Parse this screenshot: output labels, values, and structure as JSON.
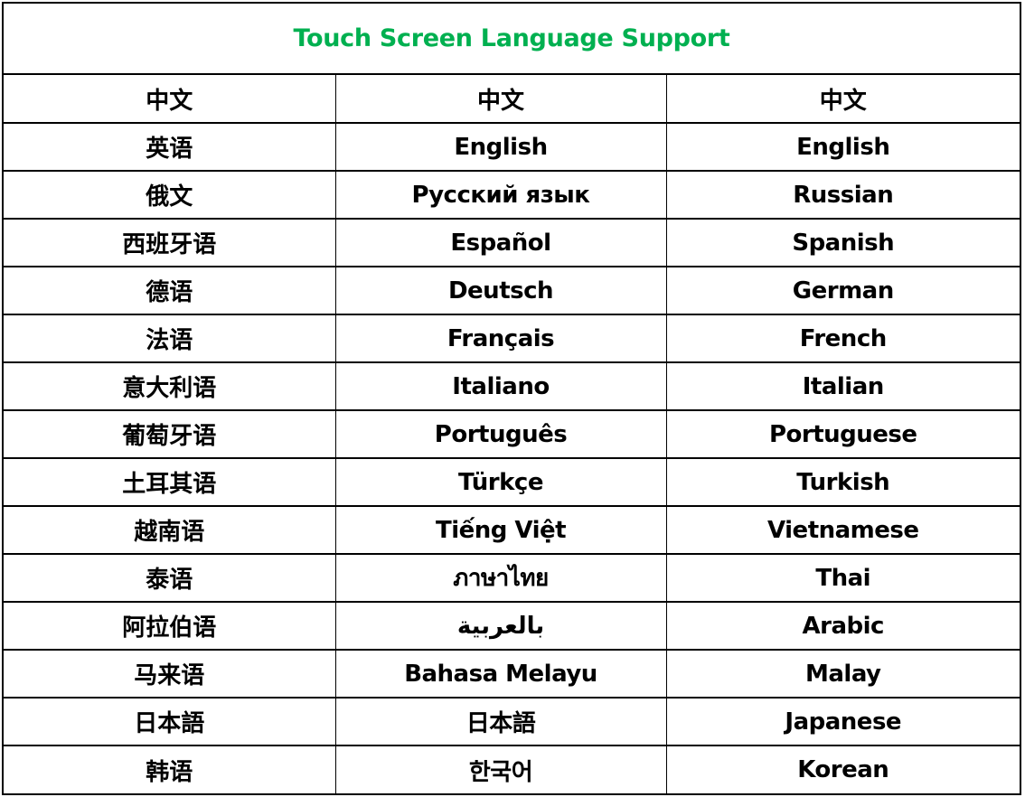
{
  "document": {
    "title": "Touch Screen Language Support",
    "title_color": "#00b050",
    "header": [
      "中文",
      "中文",
      "中文"
    ],
    "rows": [
      {
        "chinese": "英语",
        "native": "English",
        "english": "English"
      },
      {
        "chinese": "俄文",
        "native": "Русский язык",
        "english": "Russian"
      },
      {
        "chinese": "西班牙语",
        "native": "Español",
        "english": "Spanish"
      },
      {
        "chinese": "德语",
        "native": "Deutsch",
        "english": "German"
      },
      {
        "chinese": "法语",
        "native": "Français",
        "english": "French"
      },
      {
        "chinese": "意大利语",
        "native": "Italiano",
        "english": "Italian"
      },
      {
        "chinese": "葡萄牙语",
        "native": "Português",
        "english": "Portuguese"
      },
      {
        "chinese": "土耳其语",
        "native": "Türkçe",
        "english": "Turkish"
      },
      {
        "chinese": "越南语",
        "native": "Tiếng Việt",
        "english": "Vietnamese"
      },
      {
        "chinese": "泰语",
        "native": "ภาษาไทย",
        "english": "Thai"
      },
      {
        "chinese": "阿拉伯语",
        "native": "بالعربية",
        "english": "Arabic"
      },
      {
        "chinese": "马来语",
        "native": "Bahasa Melayu",
        "english": "Malay"
      },
      {
        "chinese": "日本語",
        "native": "日本語",
        "english": "Japanese"
      },
      {
        "chinese": "韩语",
        "native": "한국어",
        "english": "Korean"
      }
    ]
  }
}
